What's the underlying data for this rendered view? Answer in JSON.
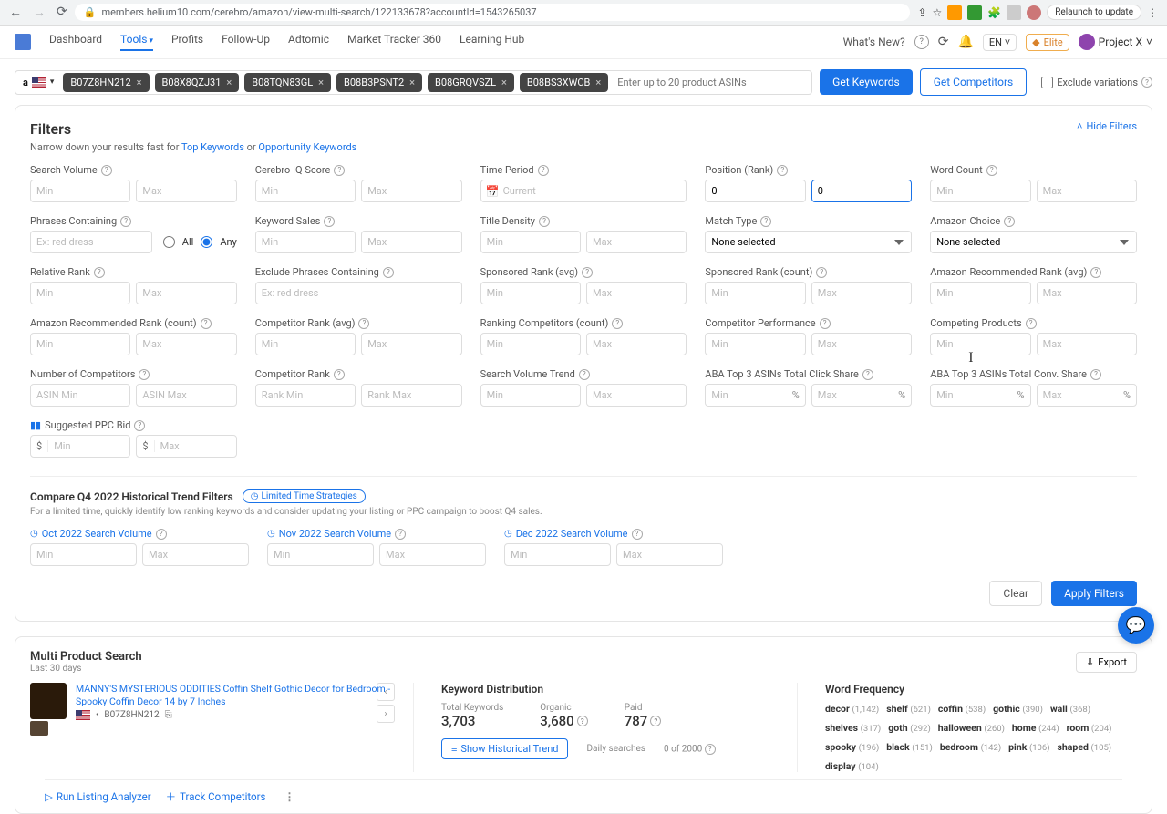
{
  "browser": {
    "url": "members.helium10.com/cerebro/amazon/view-multi-search/122133678?accountId=1543265037",
    "relaunch": "Relaunch to update"
  },
  "nav": {
    "items": [
      "Dashboard",
      "Tools",
      "Profits",
      "Follow-Up",
      "Adtomic",
      "Market Tracker 360",
      "Learning Hub"
    ],
    "activeIndex": 1,
    "whatsNew": "What's New?",
    "lang": "EN",
    "elite": "Elite",
    "project": "Project X"
  },
  "asinBar": {
    "chips": [
      "B07Z8HN212",
      "B08X8QZJ31",
      "B08TQN83GL",
      "B08B3PSNT2",
      "B08GRQVSZL",
      "B08BS3XWCB"
    ],
    "placeholder": "Enter up to 20 product ASINs",
    "getKeywords": "Get Keywords",
    "getCompetitors": "Get Competitors",
    "exclude": "Exclude variations"
  },
  "filters": {
    "title": "Filters",
    "sub_pre": "Narrow down your results fast for ",
    "topKw": "Top Keywords",
    "or": " or ",
    "oppKw": "Opportunity Keywords",
    "hide": "Hide Filters",
    "labels": {
      "searchVolume": "Search Volume",
      "cerebroIQ": "Cerebro IQ Score",
      "timePeriod": "Time Period",
      "position": "Position (Rank)",
      "wordCount": "Word Count",
      "phrasesContaining": "Phrases Containing",
      "keywordSales": "Keyword Sales",
      "titleDensity": "Title Density",
      "matchType": "Match Type",
      "amazonChoice": "Amazon Choice",
      "relativeRank": "Relative Rank",
      "excludePhrases": "Exclude Phrases Containing",
      "sponsoredRankAvg": "Sponsored Rank (avg)",
      "sponsoredRankCount": "Sponsored Rank (count)",
      "amzRecRankAvg": "Amazon Recommended Rank (avg)",
      "amzRecRankCount": "Amazon Recommended Rank (count)",
      "competitorRankAvg": "Competitor Rank (avg)",
      "rankingCompCount": "Ranking Competitors (count)",
      "competitorPerf": "Competitor Performance",
      "competingProducts": "Competing Products",
      "numCompetitors": "Number of Competitors",
      "competitorRank": "Competitor Rank",
      "svTrend": "Search Volume Trend",
      "abaClick": "ABA Top 3 ASINs Total Click Share",
      "abaConv": "ABA Top 3 ASINs Total Conv. Share",
      "suggestedPPC": "Suggested PPC Bid"
    },
    "placeholders": {
      "min": "Min",
      "max": "Max",
      "current": "Current",
      "exRed": "Ex: red dress",
      "noneSelected": "None selected",
      "asinMin": "ASIN Min",
      "asinMax": "ASIN Max",
      "rankMin": "Rank Min",
      "rankMax": "Rank Max"
    },
    "values": {
      "positionMin": "0",
      "positionMax": "0"
    },
    "radio": {
      "all": "All",
      "any": "Any"
    },
    "trend": {
      "title": "Compare Q4 2022 Historical Trend Filters",
      "badge": "Limited Time Strategies",
      "sub": "For a limited time, quickly identify low ranking keywords and consider updating your listing or PPC campaign to boost Q4 sales.",
      "oct": "Oct 2022 Search Volume",
      "nov": "Nov 2022 Search Volume",
      "dec": "Dec 2022 Search Volume"
    },
    "clear": "Clear",
    "apply": "Apply Filters"
  },
  "results": {
    "mpsTitle": "Multi Product Search",
    "mpsSub": "Last 30 days",
    "export": "Export",
    "productTitle": "MANNY'S MYSTERIOUS ODDITIES Coffin Shelf Gothic Decor for Bedroom - Spooky Coffin Decor 14 by 7 Inches",
    "productAsin": "B07Z8HN212",
    "kd": {
      "title": "Keyword Distribution",
      "totalLabel": "Total Keywords",
      "totalVal": "3,703",
      "organicLabel": "Organic",
      "organicVal": "3,680",
      "paidLabel": "Paid",
      "paidVal": "787",
      "showTrend": "Show Historical Trend",
      "dailyLabel": "Daily searches",
      "dailyVal": "0 of 2000"
    },
    "wf": {
      "title": "Word Frequency",
      "tags": [
        {
          "w": "decor",
          "c": "(1,142)"
        },
        {
          "w": "shelf",
          "c": "(621)"
        },
        {
          "w": "coffin",
          "c": "(538)"
        },
        {
          "w": "gothic",
          "c": "(390)"
        },
        {
          "w": "wall",
          "c": "(368)"
        },
        {
          "w": "shelves",
          "c": "(317)"
        },
        {
          "w": "goth",
          "c": "(292)"
        },
        {
          "w": "halloween",
          "c": "(260)"
        },
        {
          "w": "home",
          "c": "(244)"
        },
        {
          "w": "room",
          "c": "(204)"
        },
        {
          "w": "spooky",
          "c": "(196)"
        },
        {
          "w": "black",
          "c": "(151)"
        },
        {
          "w": "bedroom",
          "c": "(142)"
        },
        {
          "w": "pink",
          "c": "(106)"
        },
        {
          "w": "shaped",
          "c": "(105)"
        },
        {
          "w": "display",
          "c": "(104)"
        }
      ]
    },
    "runListing": "Run Listing Analyzer",
    "trackComp": "Track Competitors"
  }
}
